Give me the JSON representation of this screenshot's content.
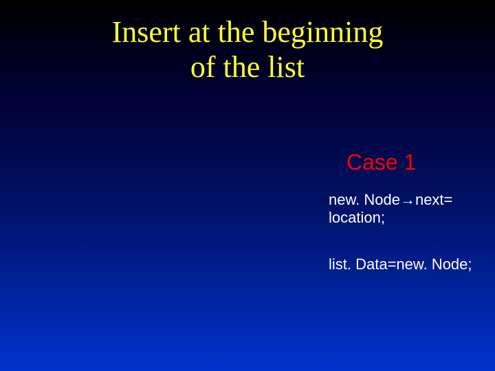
{
  "title_line1": "Insert at the beginning",
  "title_line2": "of the list",
  "case_label": "Case 1",
  "code_line1": "new. Node→next=",
  "code_line2": "location;",
  "code_line3": "list. Data=new. Node;"
}
